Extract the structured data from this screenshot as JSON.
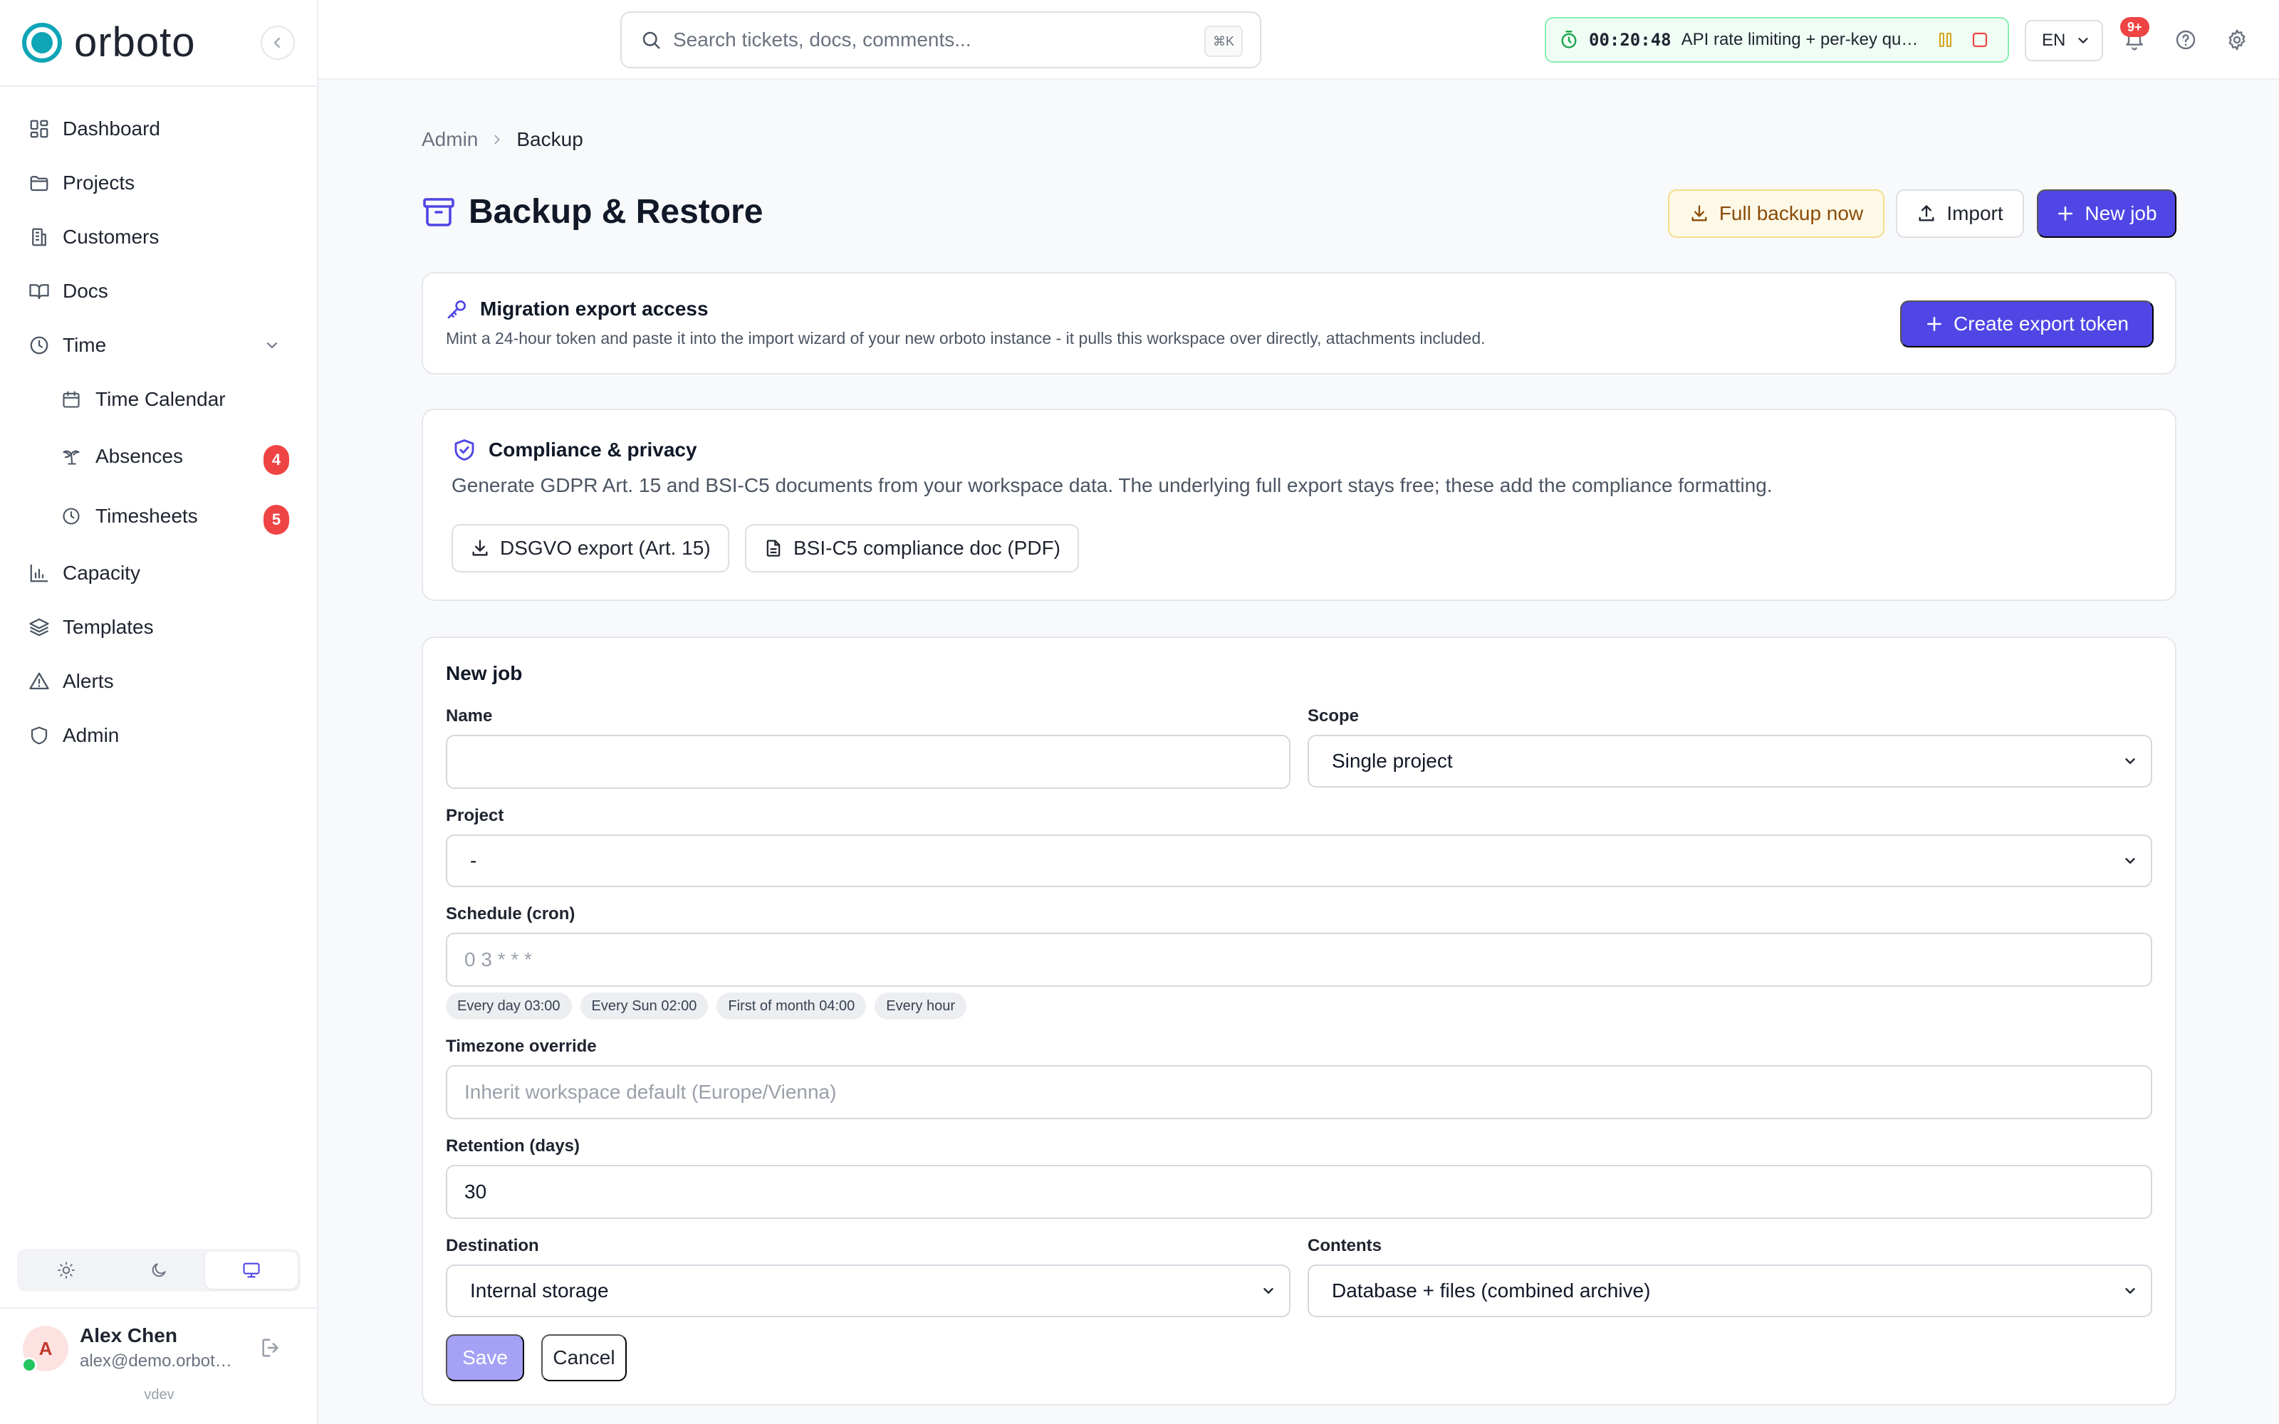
{
  "brand": {
    "name": "orboto"
  },
  "sidebar": {
    "items": [
      {
        "label": "Dashboard"
      },
      {
        "label": "Projects"
      },
      {
        "label": "Customers"
      },
      {
        "label": "Docs"
      },
      {
        "label": "Time"
      },
      {
        "label": "Time Calendar"
      },
      {
        "label": "Absences",
        "badge": "4"
      },
      {
        "label": "Timesheets",
        "badge": "5"
      },
      {
        "label": "Capacity"
      },
      {
        "label": "Templates"
      },
      {
        "label": "Alerts"
      },
      {
        "label": "Admin"
      }
    ],
    "theme_options": [
      "light",
      "dark",
      "system"
    ],
    "theme_selected": "system"
  },
  "user": {
    "initial": "A",
    "name": "Alex Chen",
    "email": "alex@demo.orboto.io",
    "version": "vdev"
  },
  "topbar": {
    "search_placeholder": "Search tickets, docs, comments...",
    "search_shortcut": "⌘K",
    "timer_time": "00:20:48",
    "timer_task": "API rate limiting + per-key quotas",
    "language": "EN",
    "notification_count": "9+"
  },
  "breadcrumb": {
    "root": "Admin",
    "current": "Backup"
  },
  "page": {
    "title": "Backup & Restore",
    "full_backup_label": "Full backup now",
    "import_label": "Import",
    "new_job_label": "New job"
  },
  "migration": {
    "title": "Migration export access",
    "description": "Mint a 24-hour token and paste it into the import wizard of your new orboto instance - it pulls this workspace over directly, attachments included.",
    "button_label": "Create export token"
  },
  "compliance": {
    "title": "Compliance & privacy",
    "description": "Generate GDPR Art. 15 and BSI-C5 documents from your workspace data. The underlying full export stays free; these add the compliance formatting.",
    "dsgvo_label": "DSGVO export (Art. 15)",
    "bsi_label": "BSI-C5 compliance doc (PDF)"
  },
  "job_form": {
    "heading": "New job",
    "name_label": "Name",
    "name_value": "",
    "scope_label": "Scope",
    "scope_value": "Single project",
    "project_label": "Project",
    "project_value": "-",
    "schedule_label": "Schedule (cron)",
    "schedule_placeholder": "0 3 * * *",
    "presets": [
      "Every day 03:00",
      "Every Sun 02:00",
      "First of month 04:00",
      "Every hour"
    ],
    "timezone_label": "Timezone override",
    "timezone_placeholder": "Inherit workspace default (Europe/Vienna)",
    "retention_label": "Retention (days)",
    "retention_value": "30",
    "destination_label": "Destination",
    "destination_value": "Internal storage",
    "contents_label": "Contents",
    "contents_value": "Database + files (combined archive)",
    "save_label": "Save",
    "cancel_label": "Cancel"
  },
  "colors": {
    "accent": "#4f46e5",
    "brand_teal": "#0ea5b7",
    "badge_red": "#ef4444",
    "timer_green": "#16a34a",
    "warning_bg": "#fef9e7"
  }
}
